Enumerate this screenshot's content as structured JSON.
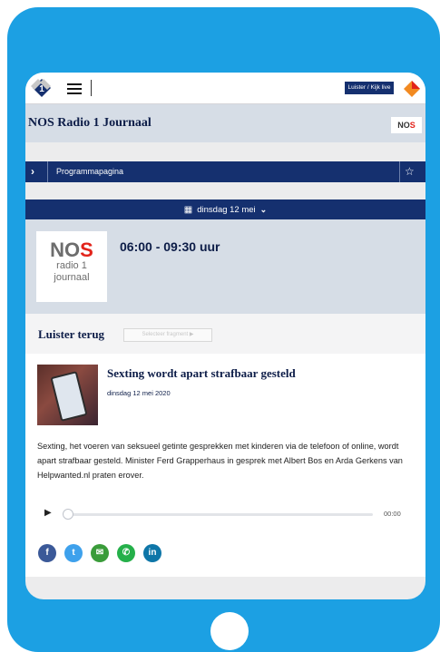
{
  "topbar": {
    "listen_live": "Luister / Kijk live",
    "icons": [
      "npo-radio1-logo",
      "hamburger-icon",
      "npo-logo"
    ]
  },
  "program": {
    "title": "NOS Radio 1 Journaal",
    "badge": "NOS",
    "page_link": "Programmapagina",
    "date": "dinsdag 12 mei",
    "logo_lines": [
      "NOS",
      "radio 1",
      "journaal"
    ],
    "time": "06:00 - 09:30 uur"
  },
  "listen_back": {
    "label": "Luister terug",
    "button": "Selecteer fragment"
  },
  "article": {
    "title": "Sexting wordt apart strafbaar gesteld",
    "date": "dinsdag 12 mei 2020",
    "body": "Sexting, het voeren van seksueel getinte gesprekken met kinderen via de telefoon of online, wordt apart strafbaar gesteld. Minister Ferd Grapperhaus in gesprek met Albert Bos en Arda Gerkens van Helpwanted.nl praten erover.",
    "player": {
      "time": "00:00",
      "progress": 0
    }
  },
  "share": {
    "buttons": [
      {
        "name": "facebook-icon",
        "glyph": "f",
        "color": "#3b5998"
      },
      {
        "name": "twitter-icon",
        "glyph": "t",
        "color": "#3ea1ec"
      },
      {
        "name": "email-icon",
        "glyph": "✉",
        "color": "#3a9c3a"
      },
      {
        "name": "whatsapp-icon",
        "glyph": "✆",
        "color": "#25b04a"
      },
      {
        "name": "linkedin-icon",
        "glyph": "in",
        "color": "#0e76a8"
      }
    ]
  },
  "colors": {
    "frame": "#1ca0e3",
    "navy": "#15306f",
    "accent_red": "#e2231a"
  }
}
